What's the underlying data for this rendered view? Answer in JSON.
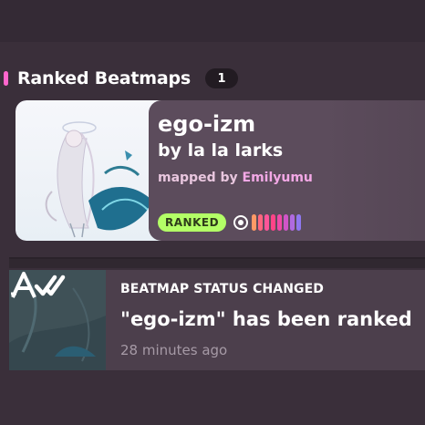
{
  "section": {
    "title": "Ranked Beatmaps",
    "count": "1",
    "accent_color": "#ff66cc"
  },
  "beatmap": {
    "title": "ego-izm",
    "artist_line": "by la la larks",
    "mapped_by_prefix": "mapped by ",
    "mapper": "Emilyumu",
    "status": "RANKED",
    "mode_icon": "osu-standard-icon",
    "difficulty_colors": [
      "#ff9966",
      "#ff6680",
      "#ff5599",
      "#ff4488",
      "#f04aa8",
      "#d055c8",
      "#b06ae0",
      "#8f78f0"
    ]
  },
  "notification": {
    "heading": "BEATMAP STATUS CHANGED",
    "message": "\"ego-izm\" has been ranked",
    "time": "28 minutes ago",
    "icon": "beatmap-ranked-icon"
  }
}
